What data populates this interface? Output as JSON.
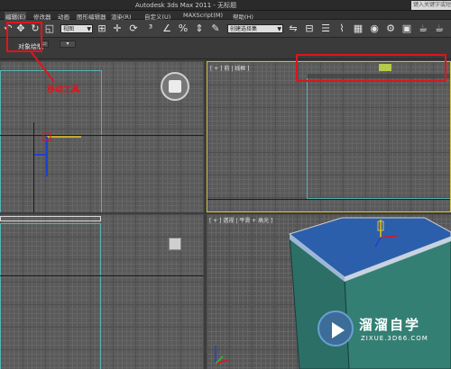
{
  "titlebar": {
    "title": "Autodesk 3ds Max  2011  -  无标题",
    "search_placeholder": "键入关键字或短语"
  },
  "menubar": {
    "items": [
      "编辑(E)",
      "修改器",
      "动画",
      "图形编辑器",
      "渲染(R)",
      "自定义(U)",
      "MAXScript(M)",
      "帮助(H)"
    ]
  },
  "toolbar": {
    "view_select": "视图",
    "selection_set": "创建选择集"
  },
  "subbar": {
    "label": "对象绘制"
  },
  "annotation": {
    "text": "移动工具"
  },
  "viewports": {
    "top_left_label": "",
    "top_right_label": "[ + ] 前 | 线框 ]",
    "bottom_left_label": "",
    "bottom_right_label": "[ + ] 透视 | 平滑 + 高光 ]"
  },
  "watermark": {
    "brand": "溜溜自学",
    "url": "ZIXUE.3D66.COM"
  },
  "colors": {
    "highlight_red": "#e0141c",
    "grid_gray": "#5a5a5a",
    "object_top_blue": "#2a5fa8",
    "object_side_teal": "#2e7f76",
    "frame_cyan": "#53b4b0",
    "active_yellow": "#d4c24a"
  },
  "icons": [
    "move-icon",
    "rotate-icon",
    "scale-icon",
    "select-icon",
    "link-icon",
    "snap-icon",
    "mirror-icon",
    "align-icon",
    "render-icon"
  ]
}
